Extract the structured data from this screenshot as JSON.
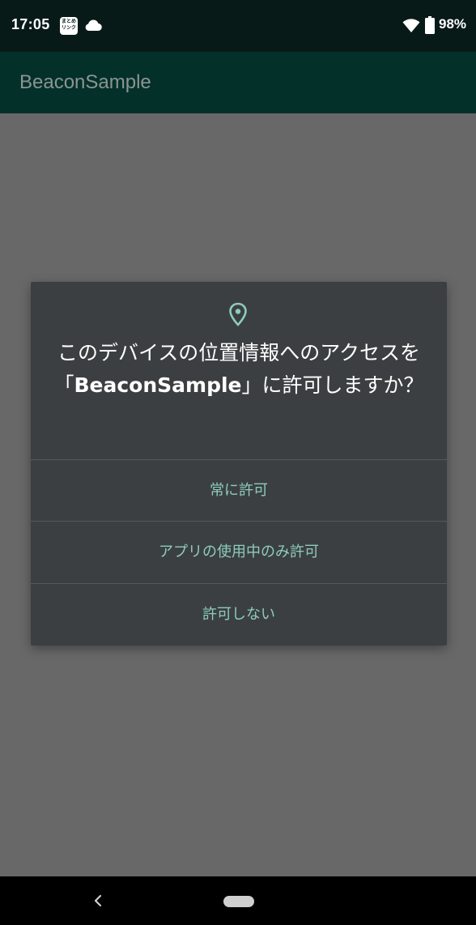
{
  "status_bar": {
    "time": "17:05",
    "notification_icon_text": "まとめリンク",
    "battery_percent": "98%",
    "icons": [
      "notification-app-icon",
      "cloud-icon",
      "wifi-icon",
      "battery-icon"
    ]
  },
  "app_bar": {
    "title": "BeaconSample"
  },
  "dialog": {
    "icon": "location-pin-icon",
    "message_before": "このデバイスの位置情報へのアクセスを「",
    "app_name": "BeaconSample",
    "message_after": "」に許可しますか？",
    "buttons": {
      "always": "常に許可",
      "while_in_use": "アプリの使用中のみ許可",
      "deny": "許可しない"
    }
  },
  "nav_bar": {
    "icons": [
      "back-icon",
      "home-pill-icon"
    ]
  },
  "colors": {
    "status_bar_bg": "#071a17",
    "app_bar_bg": "#04302a",
    "scrim": "#686868",
    "dialog_bg": "#3c3f41",
    "accent": "#8ccdb9"
  }
}
